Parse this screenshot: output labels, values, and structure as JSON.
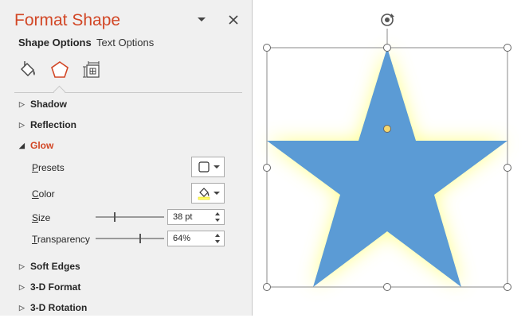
{
  "pane": {
    "title": "Format Shape",
    "tabs": [
      "Shape Options",
      "Text Options"
    ],
    "categories": [
      "fill-line-icon",
      "effects-icon",
      "size-properties-icon"
    ]
  },
  "sections": {
    "shadow": "Shadow",
    "reflection": "Reflection",
    "glow": "Glow",
    "soft_edges": "Soft Edges",
    "format_3d": "3-D Format",
    "rotation_3d": "3-D Rotation"
  },
  "glow": {
    "presets_label_accel": "P",
    "presets_label_rest": "resets",
    "color_label_accel": "C",
    "color_label_rest": "olor",
    "size_label_accel": "S",
    "size_label_rest": "ize",
    "size_value": "38 pt",
    "size_level": 0.27,
    "transparency_label_accel": "T",
    "transparency_label_rest": "ransparency",
    "transparency_value": "64%",
    "transparency_level": 0.64,
    "glow_color": "#ffff66"
  },
  "shape": {
    "type": "five-point star",
    "fill_color": "#5b9bd5",
    "selected": true
  },
  "colors": {
    "accent": "#d24726"
  }
}
